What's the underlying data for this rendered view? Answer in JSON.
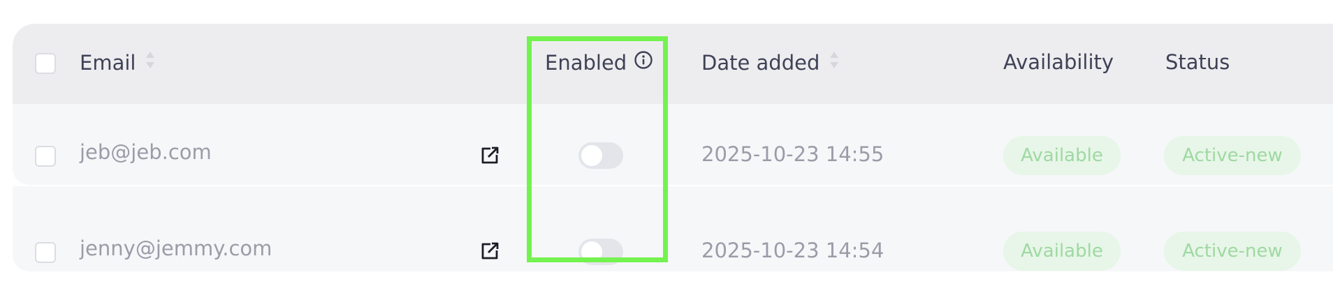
{
  "table": {
    "headers": {
      "email": "Email",
      "enabled": "Enabled",
      "date_added": "Date added",
      "availability": "Availability",
      "status": "Status"
    },
    "rows": [
      {
        "email": "jeb@jeb.com",
        "enabled": false,
        "date_added": "2025-10-23 14:55",
        "availability": "Available",
        "status": "Active-new"
      },
      {
        "email": "jenny@jemmy.com",
        "enabled": false,
        "date_added": "2025-10-23 14:54",
        "availability": "Available",
        "status": "Active-new"
      }
    ]
  },
  "icons": {
    "sort": "sort-icon",
    "info": "info-icon",
    "open_link": "external-link-icon"
  },
  "colors": {
    "header_bg": "#ededf0",
    "row_bg": "#f6f7f9",
    "pill_bg": "#e7f6e8",
    "pill_text": "#9fd8a2",
    "highlight": "#74f24f"
  }
}
